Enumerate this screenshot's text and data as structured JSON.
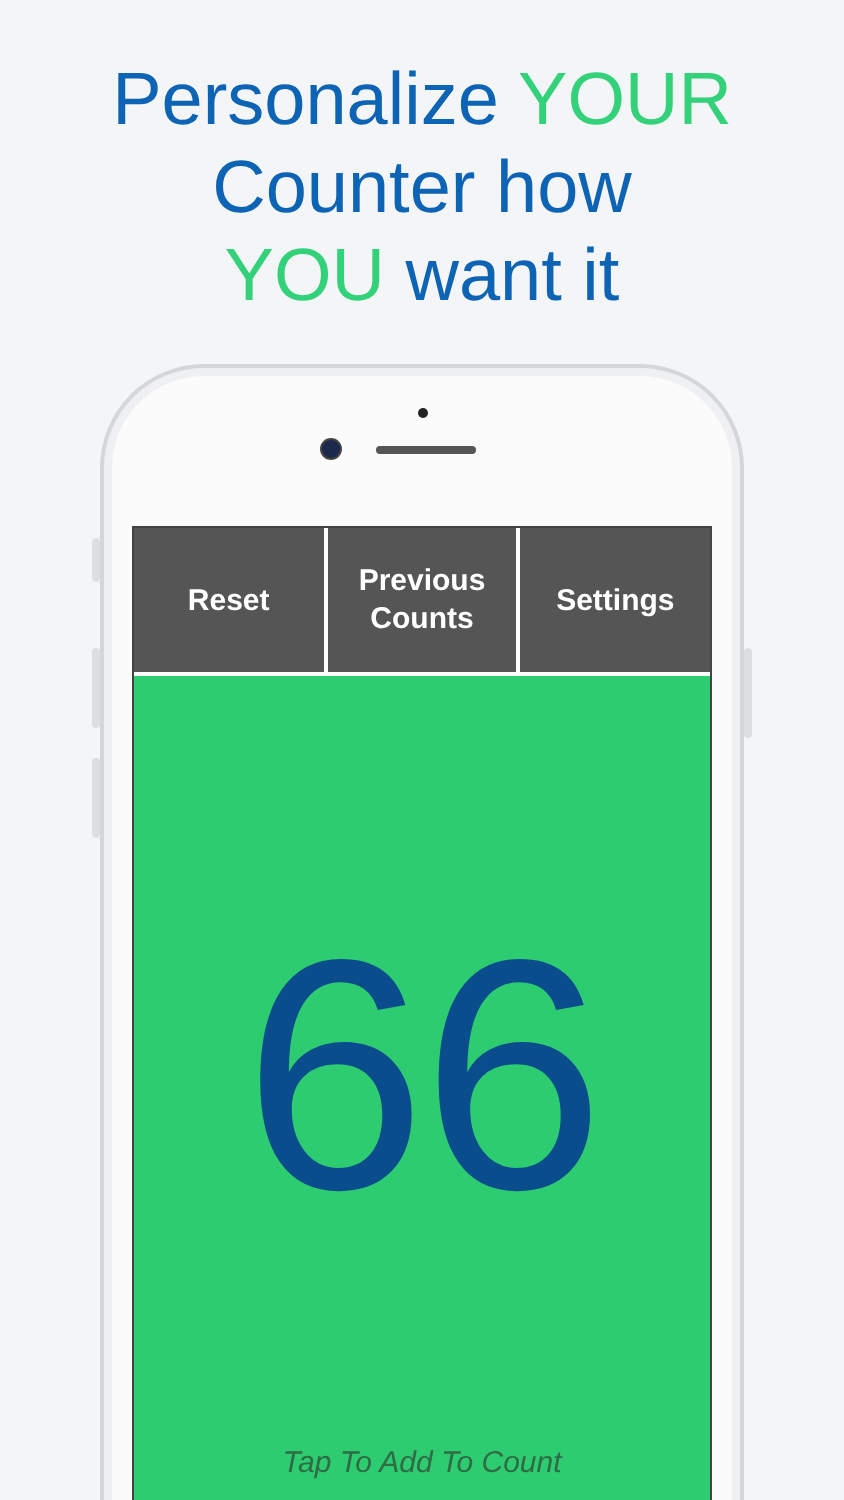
{
  "headline": [
    [
      {
        "text": "Personalize ",
        "accent": false
      },
      {
        "text": "YOUR",
        "accent": true
      }
    ],
    [
      {
        "text": "Counter how",
        "accent": false
      }
    ],
    [
      {
        "text": "YOU",
        "accent": true
      },
      {
        "text": " want it",
        "accent": false
      }
    ]
  ],
  "toolbar": [
    "Reset",
    "Previous Counts",
    "Settings"
  ],
  "counter": {
    "value": "66",
    "hint": "Tap To Add To Count"
  }
}
